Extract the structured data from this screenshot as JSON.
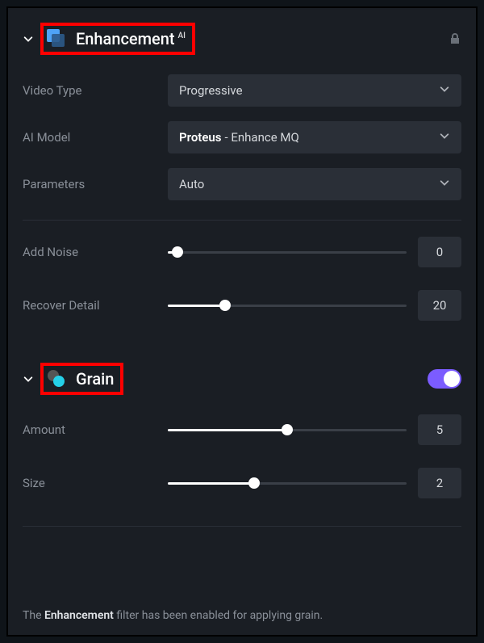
{
  "enhancement": {
    "title": "Enhancement",
    "sup": "AI",
    "video_type_label": "Video Type",
    "video_type_value": "Progressive",
    "model_label": "AI Model",
    "model_bold": "Proteus",
    "model_rest": " - Enhance MQ",
    "params_label": "Parameters",
    "params_value": "Auto",
    "add_noise_label": "Add Noise",
    "add_noise_value": "0",
    "add_noise_pct": "4",
    "recover_label": "Recover Detail",
    "recover_value": "20",
    "recover_pct": "24"
  },
  "grain": {
    "title": "Grain",
    "amount_label": "Amount",
    "amount_value": "5",
    "amount_pct": "50",
    "size_label": "Size",
    "size_value": "2",
    "size_pct": "36"
  },
  "footer": {
    "pre": "The ",
    "em": "Enhancement",
    "post": " filter has been enabled for applying grain."
  }
}
